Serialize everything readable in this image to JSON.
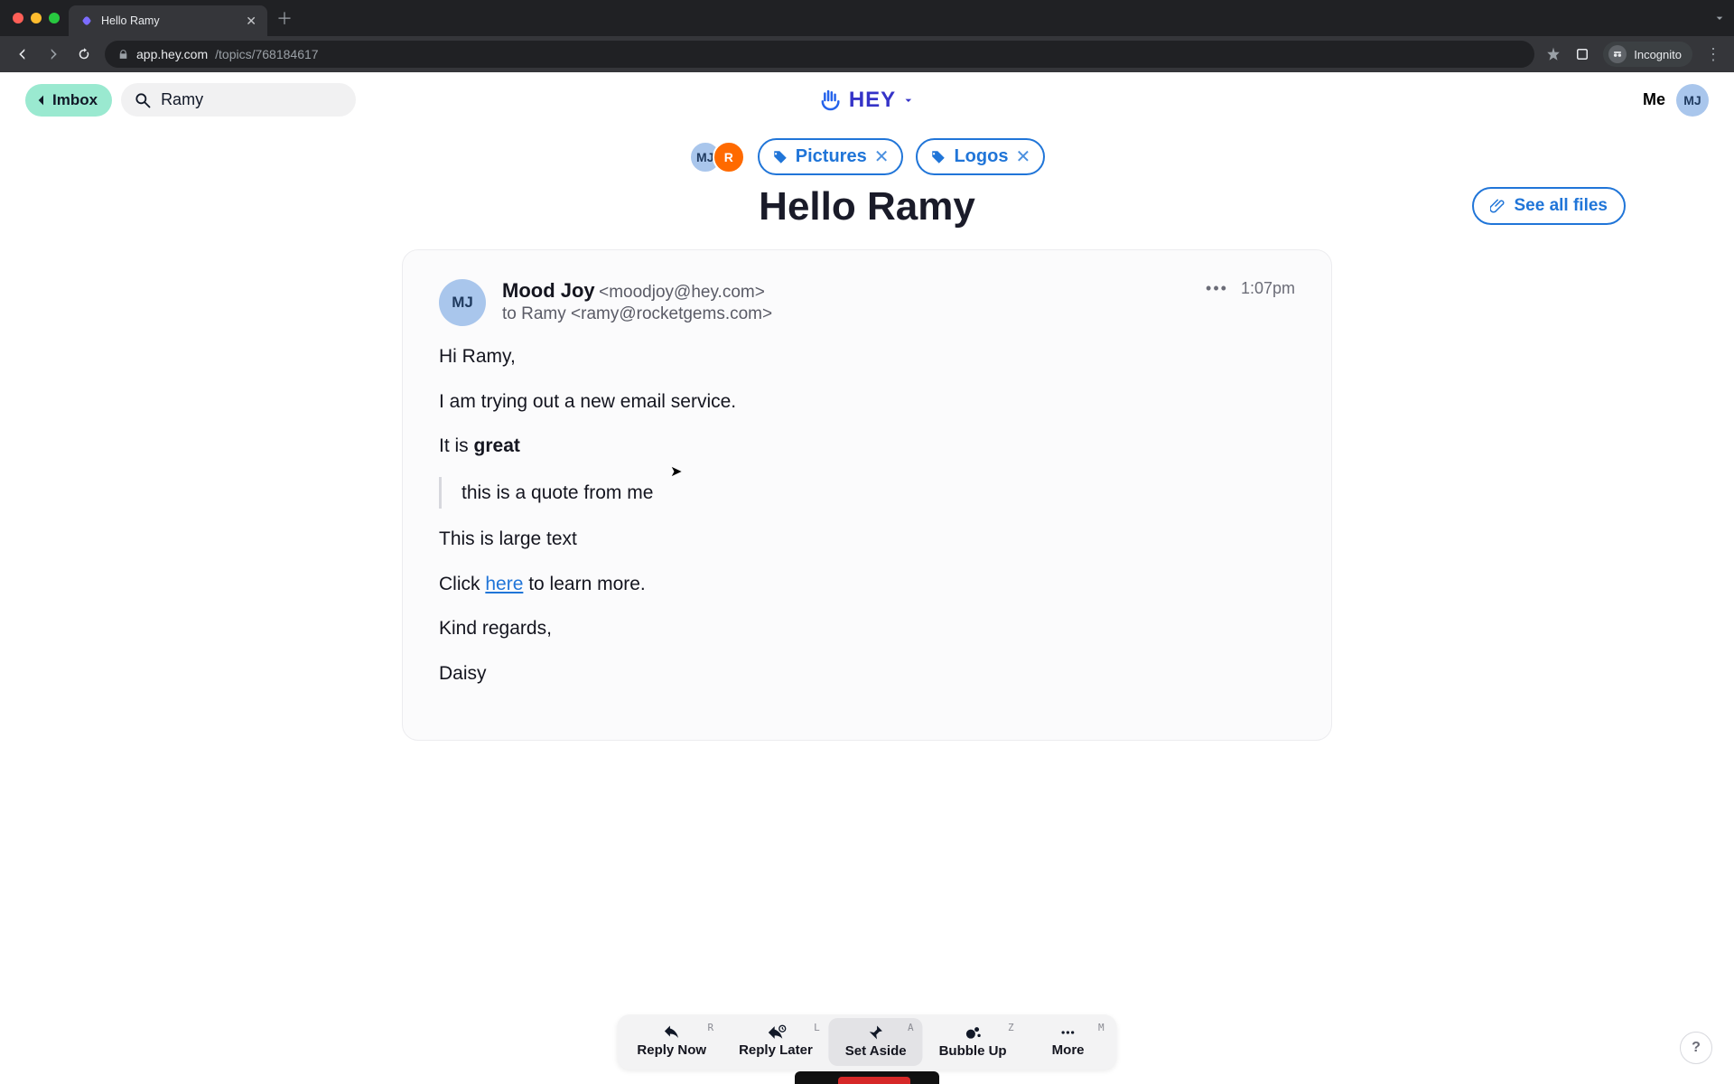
{
  "browser": {
    "tab_title": "Hello Ramy",
    "url_host": "app.hey.com",
    "url_path": "/topics/768184617",
    "incognito_label": "Incognito"
  },
  "header": {
    "imbox_label": "Imbox",
    "search_value": "Ramy",
    "logo_text": "HEY",
    "me_label": "Me",
    "me_initials": "MJ"
  },
  "thread": {
    "title": "Hello Ramy",
    "participants": [
      {
        "initials": "MJ",
        "color": "mj"
      },
      {
        "initials": "R",
        "color": "r"
      }
    ],
    "tags": [
      {
        "label": "Pictures"
      },
      {
        "label": "Logos"
      }
    ],
    "see_all_label": "See all files"
  },
  "message": {
    "from_name": "Mood Joy",
    "from_email": "<moodjoy@hey.com>",
    "to_line": "to Ramy <ramy@rocketgems.com>",
    "time": "1:07pm",
    "avatar_initials": "MJ",
    "body": {
      "greeting": "Hi Ramy,",
      "p1": "I am trying out a new email service.",
      "p2_prefix": "It is ",
      "p2_bold": "great",
      "quote": "this is a quote from me",
      "p3": "This is large text",
      "p4_prefix": "Click ",
      "p4_link": "here",
      "p4_suffix": " to learn more.",
      "closing": "Kind regards,",
      "signature": "Daisy"
    }
  },
  "actions": [
    {
      "label": "Reply Now",
      "key": "R",
      "icon": "reply"
    },
    {
      "label": "Reply Later",
      "key": "L",
      "icon": "later"
    },
    {
      "label": "Set Aside",
      "key": "A",
      "icon": "pin",
      "active": true
    },
    {
      "label": "Bubble Up",
      "key": "Z",
      "icon": "bubble"
    },
    {
      "label": "More",
      "key": "M",
      "icon": "dots"
    }
  ],
  "help_label": "?"
}
